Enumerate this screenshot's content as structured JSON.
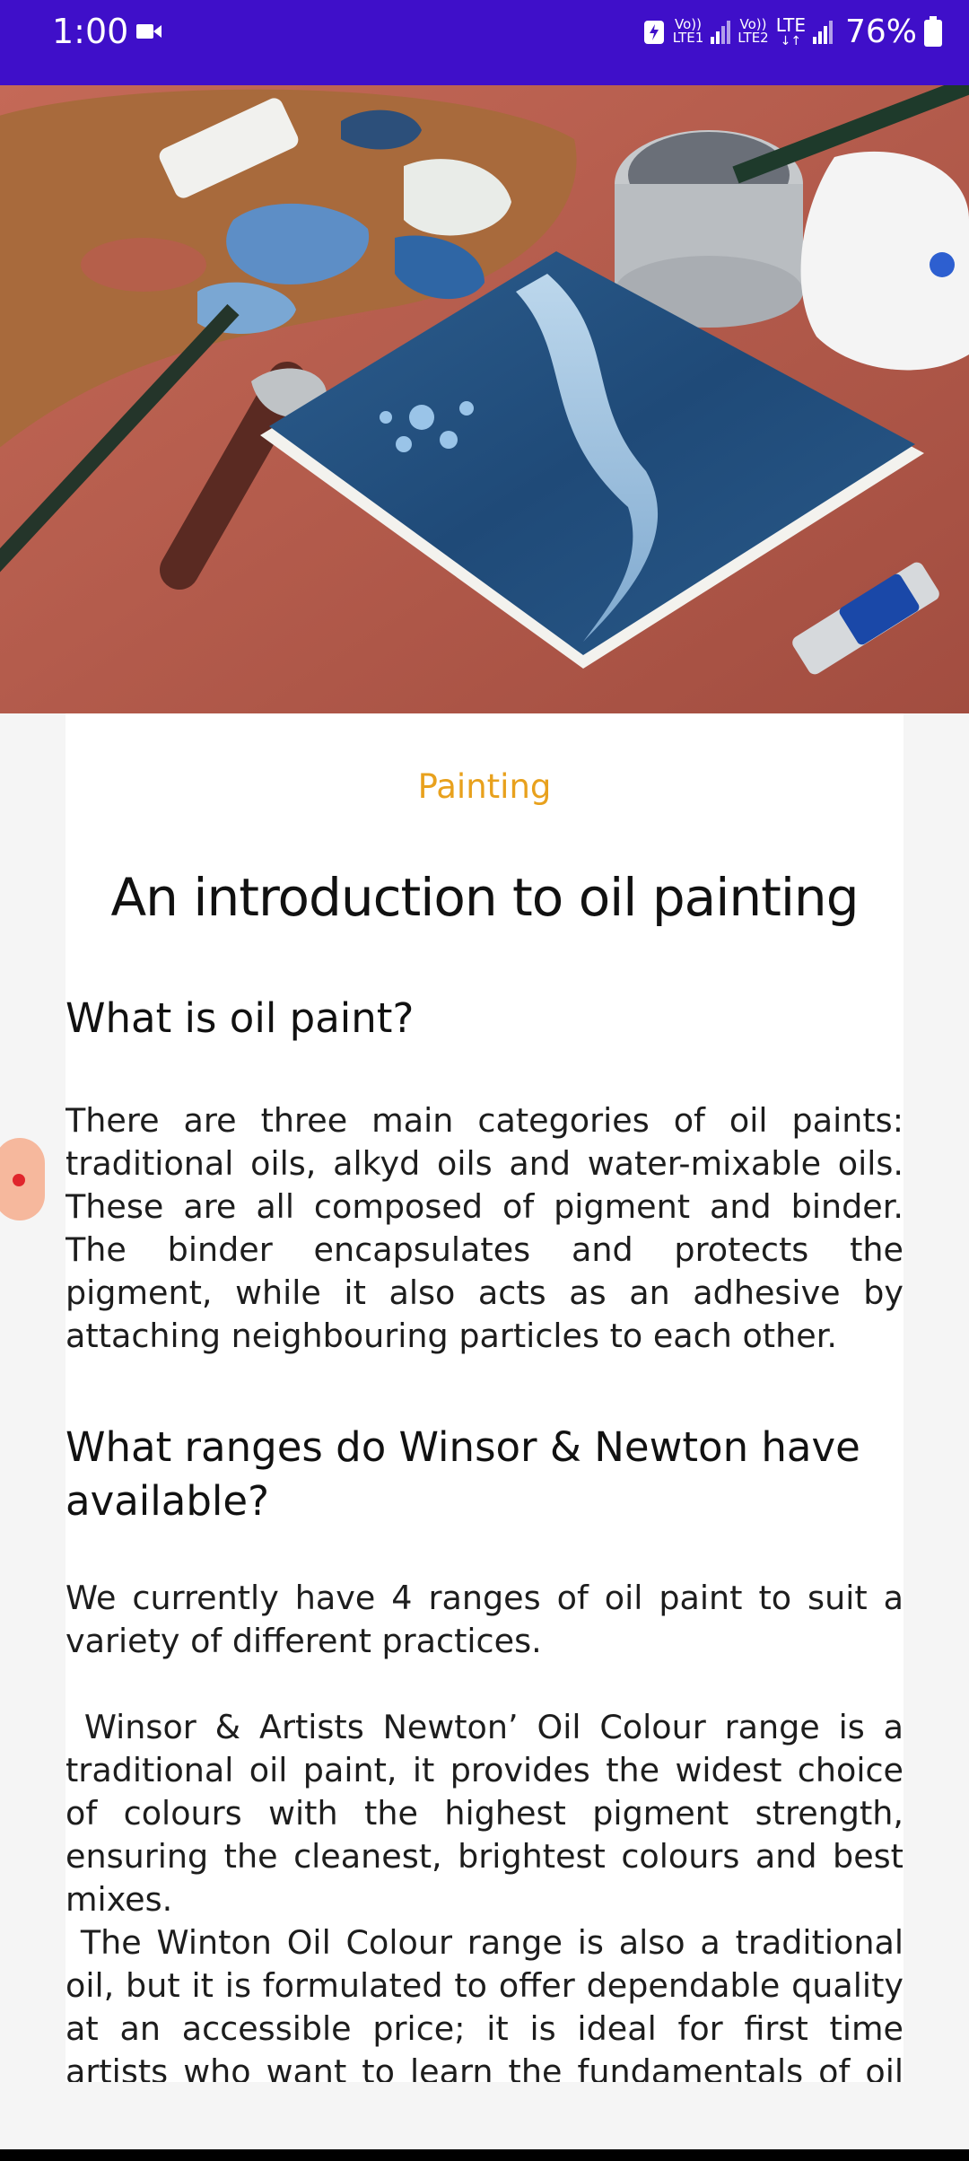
{
  "status_bar": {
    "time": "1:00",
    "sim1_top": "Vo))",
    "sim1_bottom": "LTE1",
    "sim2_top": "Vo))",
    "sim2_bottom": "LTE2",
    "network": "LTE",
    "battery_percent": "76%",
    "background_color": "#3f0fc9"
  },
  "hero": {
    "icon": "oil-painting-photo"
  },
  "article": {
    "category": "Painting",
    "category_color": "#e8a11d",
    "title": "An introduction to oil painting",
    "sections": [
      {
        "heading": "What is oil paint?",
        "paragraphs": [
          "There are three main categories of oil paints: traditional oils, alkyd oils and water-mixable oils. These are all composed of pigment and binder. The binder encapsulates and protects the pigment, while it also acts as an adhesive by attaching neighbouring particles to each other."
        ]
      },
      {
        "heading": "What ranges do Winsor & Newton have available?",
        "paragraphs": [
          "We currently have 4 ranges of oil paint to suit a variety of different practices.",
          " Winsor & Artists Newton’ Oil Colour range is a traditional oil paint, it provides the widest choice of colours with the highest pigment strength, ensuring the cleanest, brightest colours and best mixes.",
          " The Winton Oil Colour range is also a traditional oil, but it is formulated to offer dependable quality at an accessible price; it is ideal for first time artists who want to learn the fundamentals of oil painting and"
        ]
      }
    ]
  }
}
